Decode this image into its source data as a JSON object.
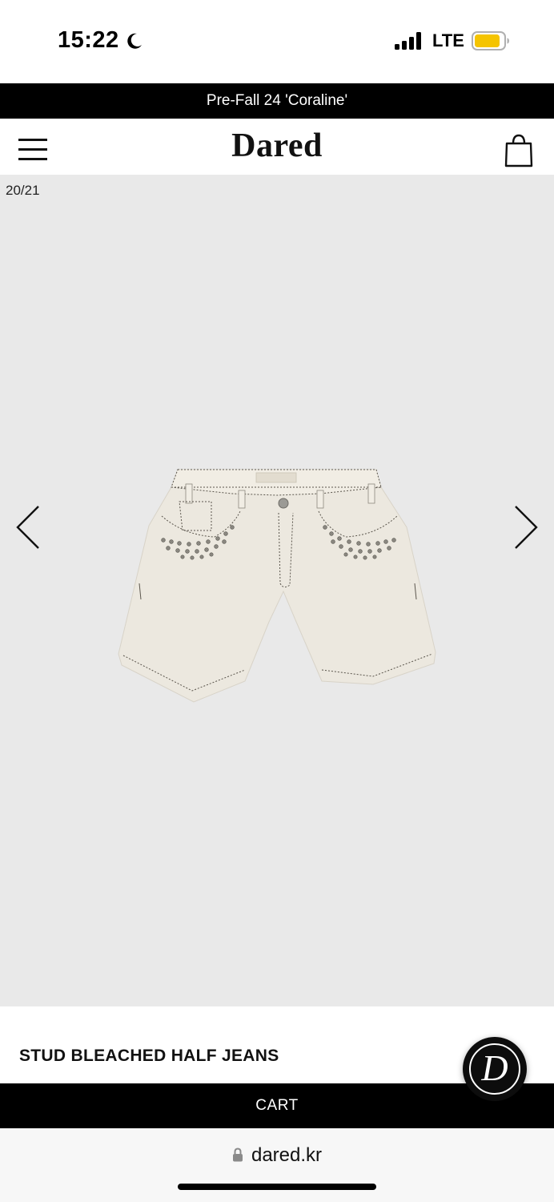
{
  "status_bar": {
    "time": "15:22",
    "network": "LTE",
    "battery_color": "#f5c400"
  },
  "promo": {
    "text": "Pre-Fall 24 'Coraline'"
  },
  "header": {
    "logo": "Dared"
  },
  "gallery": {
    "counter": "20/21",
    "background": "#e9e9e9",
    "product_image": "stud-bleached-half-jeans-photo"
  },
  "product": {
    "name": "STUD BLEACHED HALF JEANS"
  },
  "chat_badge": {
    "letter": "D"
  },
  "cart": {
    "label": "CART"
  },
  "browser": {
    "url": "dared.kr"
  },
  "icons": [
    "moon-icon",
    "signal-icon",
    "battery-icon",
    "menu-icon",
    "bag-icon",
    "chevron-left-icon",
    "chevron-right-icon",
    "lock-icon"
  ]
}
